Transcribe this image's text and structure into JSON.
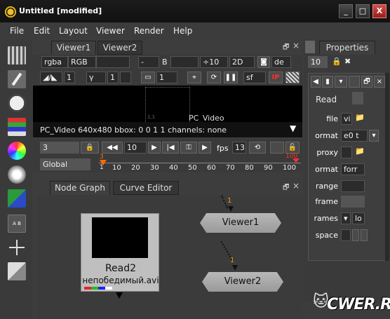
{
  "window": {
    "title": "Untitled [modified]",
    "controls": [
      "_",
      "□",
      "X"
    ]
  },
  "menu": [
    "File",
    "Edit",
    "Layout",
    "Viewer",
    "Render",
    "Help"
  ],
  "toolbar": {
    "tools": [
      "image-icon",
      "draw-icon",
      "time-icon",
      "channel-icon",
      "color-icon",
      "filter-icon",
      "keyer-icon",
      "merge-icon",
      "transform-icon",
      "3d-icon"
    ],
    "merge_label": "A B"
  },
  "viewer": {
    "tabs": [
      "Viewer1",
      "Viewer2"
    ],
    "row1": {
      "channels": "rgba",
      "display": "RGB",
      "layer_a": "-",
      "b_label": "B",
      "gain": "÷10",
      "mode": "2D",
      "de": "de"
    },
    "row2": {
      "frame_a": "1",
      "gamma_label": "γ",
      "gamma": "1",
      "proxy": "1",
      "sf": "sf",
      "ip": "IP"
    },
    "format_label": "PC_Video",
    "format_corner": "1,1",
    "info": "PC_Video 640x480 bbox: 0 0 1 1 channels: none",
    "timeline": {
      "frame": "3",
      "increment": "10",
      "fps_label": "fps",
      "fps": "13",
      "scope": "Global",
      "current": "3",
      "end": "100",
      "start_tick": "1",
      "ticks": [
        "10",
        "20",
        "30",
        "40",
        "50",
        "60",
        "70",
        "80",
        "90",
        "100"
      ]
    }
  },
  "nodegraph": {
    "tabs": [
      "Node Graph",
      "Curve Editor"
    ],
    "read_node": {
      "name": "Read2",
      "file": "непобедимый.avi"
    },
    "viewer_nodes": [
      "Viewer1",
      "Viewer2"
    ],
    "input_labels": [
      "1",
      "1"
    ]
  },
  "properties": {
    "title": "Properties",
    "max_panels": "10",
    "tab": "Read",
    "fields": [
      {
        "label": "file",
        "value": "vi"
      },
      {
        "label": "ormat",
        "value": "e0 t"
      },
      {
        "label": "proxy",
        "value": ""
      },
      {
        "label": "ormat",
        "value": "forr"
      },
      {
        "label": "range",
        "value": ""
      },
      {
        "label": "frame",
        "value": ""
      },
      {
        "label": "rames",
        "value": "lo"
      },
      {
        "label": "space",
        "value": ""
      }
    ]
  },
  "watermark": "CWER.RU",
  "colors": {
    "accent_red": "#ff2020",
    "bg": "#3c3c3c",
    "timeline_marker": "#ff6a00"
  }
}
